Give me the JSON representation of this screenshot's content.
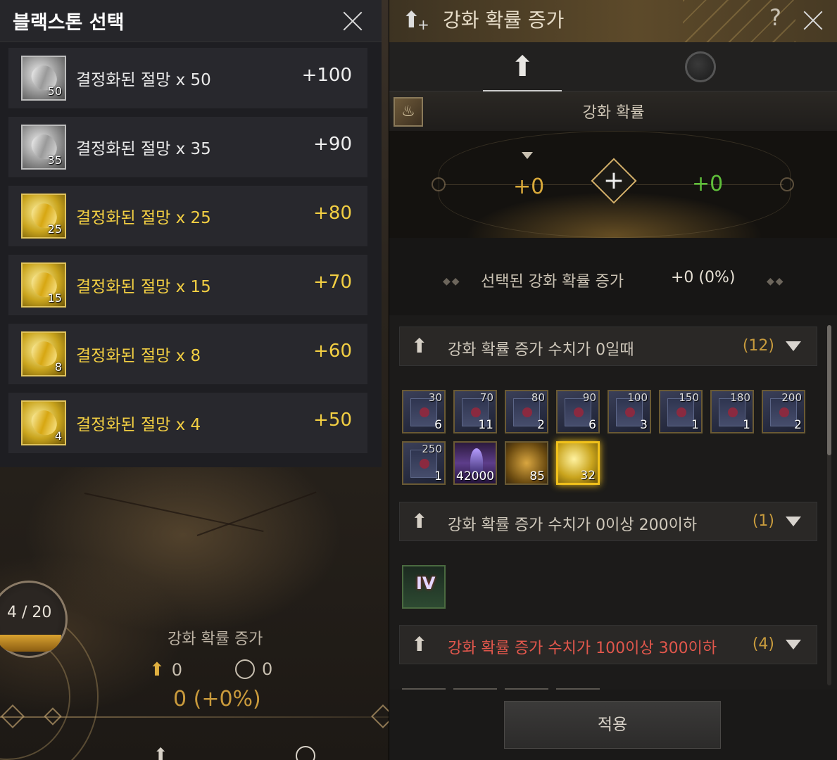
{
  "left_panel": {
    "title": "블랙스톤 선택",
    "items": [
      {
        "name": "결정화된 절망 x 50",
        "qty": "50",
        "value": "+100",
        "tier": "silver"
      },
      {
        "name": "결정화된 절망 x 35",
        "qty": "35",
        "value": "+90",
        "tier": "silver"
      },
      {
        "name": "결정화된 절망 x 25",
        "qty": "25",
        "value": "+80",
        "tier": "gold"
      },
      {
        "name": "결정화된 절망 x 15",
        "qty": "15",
        "value": "+70",
        "tier": "gold"
      },
      {
        "name": "결정화된 절망 x 8",
        "qty": "8",
        "value": "+60",
        "tier": "gold"
      },
      {
        "name": "결정화된 절망 x 4",
        "qty": "4",
        "value": "+50",
        "tier": "gold"
      }
    ]
  },
  "background": {
    "counter": "4 / 20",
    "summary_title": "강화 확률 증가",
    "summary_a": "0",
    "summary_b": "0",
    "summary_total": "0 (+0%)"
  },
  "right_panel": {
    "title": "강화 확률 증가",
    "help": "?",
    "prob_label": "강화 확률",
    "gauge_left": "+0",
    "gauge_right": "+0",
    "selected_label": "선택된 강화 확률 증가",
    "selected_value": "+0 (0%)",
    "groups": [
      {
        "text": "강화 확률 증가 수치가 0일때",
        "count": "(12)"
      },
      {
        "text": "강화 확률 증가 수치가 0이상 200이하",
        "count": "(1)"
      },
      {
        "text": "강화 확률 증가 수치가 100이상 300이하",
        "count": "(4)"
      }
    ],
    "group1_items": [
      {
        "top": "30",
        "bottom": "6"
      },
      {
        "top": "70",
        "bottom": "11"
      },
      {
        "top": "80",
        "bottom": "2"
      },
      {
        "top": "90",
        "bottom": "6"
      },
      {
        "top": "100",
        "bottom": "3"
      },
      {
        "top": "150",
        "bottom": "1"
      },
      {
        "top": "180",
        "bottom": "1"
      },
      {
        "top": "200",
        "bottom": "2"
      },
      {
        "top": "250",
        "bottom": "1"
      }
    ],
    "group1_special": [
      {
        "bottom": "42000"
      },
      {
        "bottom": "85"
      },
      {
        "bottom": "32"
      }
    ],
    "group2_item": "IV",
    "apply_label": "적용"
  },
  "colors": {
    "gold_text": "#f3cf43",
    "accent_gold": "#c99a3c",
    "green_value": "#5fbf3a",
    "red_group": "#e2574c"
  }
}
